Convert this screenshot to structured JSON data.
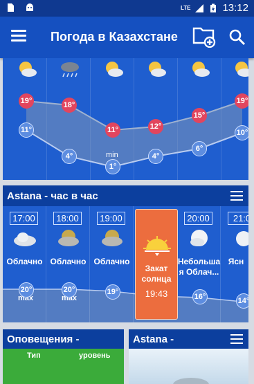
{
  "status_bar": {
    "time": "13:12",
    "network": "LTE",
    "icons": [
      "sd-card-icon",
      "android-icon",
      "signal-icon",
      "battery-icon"
    ]
  },
  "app_bar": {
    "title": "Погода в Казахстане",
    "icons": [
      "menu-icon",
      "add-folder-icon",
      "search-icon"
    ]
  },
  "daily": {
    "columns": [
      {
        "icon": "partly-cloudy-icon",
        "high": "19°",
        "low": "11°"
      },
      {
        "icon": "rain-icon",
        "high": "18°",
        "low": "4°"
      },
      {
        "icon": "partly-cloudy-icon",
        "high": "11°",
        "low": "1°",
        "low_note": "min"
      },
      {
        "icon": "partly-cloudy-icon",
        "high": "12°",
        "low": "4°"
      },
      {
        "icon": "partly-cloudy-icon",
        "high": "15°",
        "low": "6°"
      },
      {
        "icon": "partly-cloudy-icon",
        "high": "19°",
        "low": "10°"
      }
    ]
  },
  "hourly": {
    "title": "Astana - час в час",
    "columns": [
      {
        "time": "17:00",
        "condition": "Облачно",
        "icon": "cloudy-icon",
        "temp": "20°",
        "note": "max"
      },
      {
        "time": "18:00",
        "condition": "Облачно",
        "icon": "cloudy-icon",
        "temp": "20°",
        "note": "max"
      },
      {
        "time": "19:00",
        "condition": "Облачно",
        "icon": "cloudy-icon",
        "temp": "19°",
        "note": ""
      },
      {
        "time": "",
        "condition": "",
        "icon": "sunset-icon",
        "temp": "",
        "note": ""
      },
      {
        "time": "20:00",
        "condition": "Небольша я Облач...",
        "icon": "partly-cloudy-night-icon",
        "temp": "16°",
        "note": ""
      },
      {
        "time": "21:0",
        "condition": "Ясн",
        "icon": "clear-night-icon",
        "temp": "14°",
        "note": ""
      }
    ],
    "sunset": {
      "label": "Закат солнца",
      "time": "19:43"
    }
  },
  "alerts": {
    "title": "Оповещения -",
    "col_type": "Тип",
    "col_level": "уровень"
  },
  "city2": {
    "title": "Astana -"
  },
  "colors": {
    "app_bar": "#1550c0",
    "panel": "#1f5ecf",
    "high_dot": "#e2455e",
    "low_dot": "#5d8de0",
    "sunset": "#ec6d3e",
    "alert_green": "#3bab3a"
  }
}
